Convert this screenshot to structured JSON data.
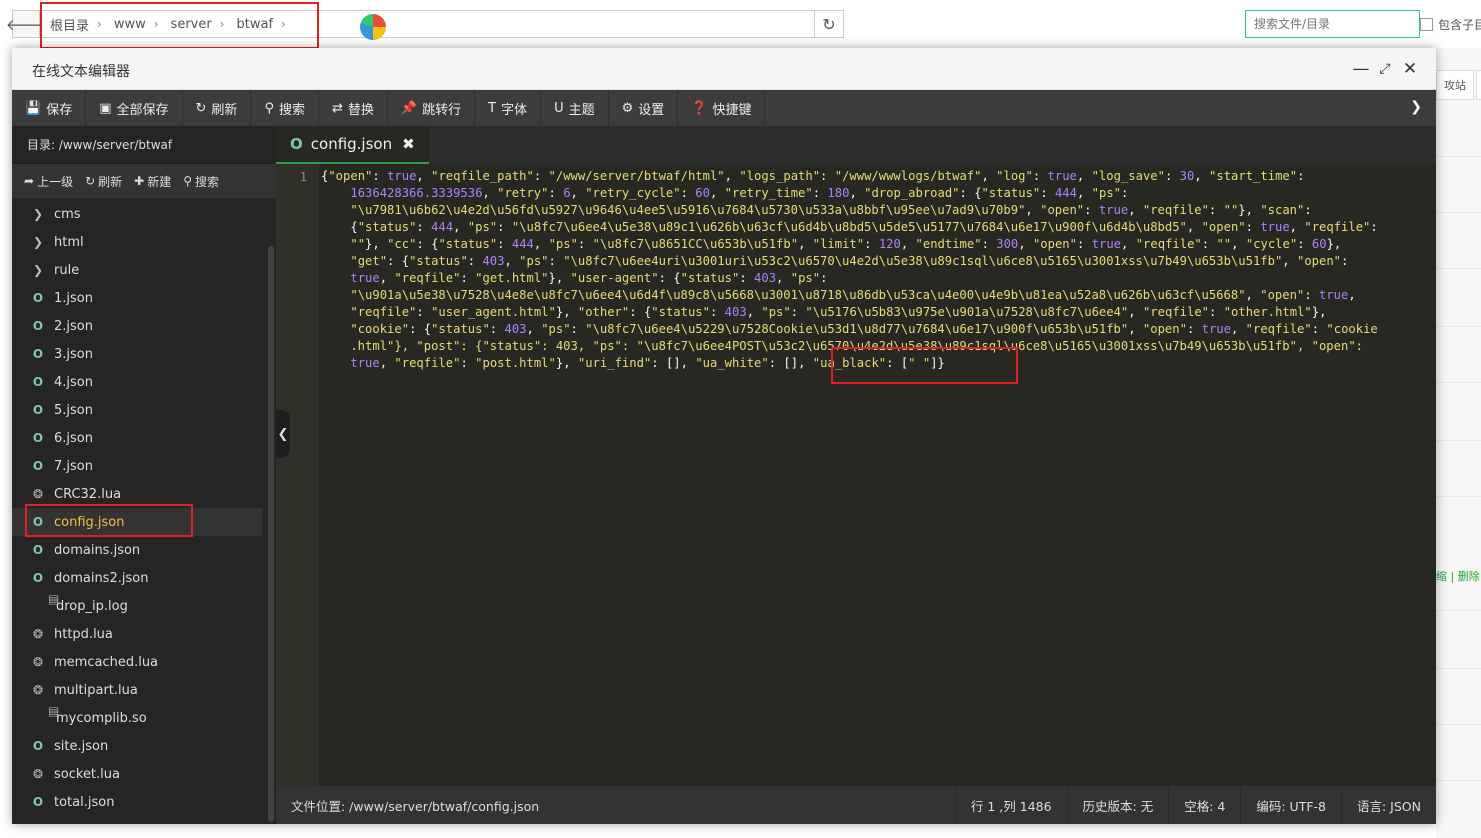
{
  "breadcrumb": {
    "items": [
      "根目录",
      "www",
      "server",
      "btwaf"
    ]
  },
  "search": {
    "placeholder": "搜索文件/目录",
    "include_sub_label": "包含子目录"
  },
  "background": {
    "tab_label": "攻站",
    "links": "缩 | 删除"
  },
  "window": {
    "title": "在线文本编辑器"
  },
  "toolbar": {
    "save": "保存",
    "save_all": "全部保存",
    "refresh": "刷新",
    "search": "搜索",
    "replace": "替换",
    "goto_line": "跳转行",
    "font": "字体",
    "theme": "主题",
    "settings": "设置",
    "shortcuts": "快捷键"
  },
  "sidebar": {
    "directory_label": "目录: /www/server/btwaf",
    "actions": {
      "up": "上一级",
      "refresh": "刷新",
      "new": "新建",
      "search": "搜索"
    },
    "files": [
      {
        "name": "cms",
        "type": "folder"
      },
      {
        "name": "html",
        "type": "folder"
      },
      {
        "name": "rule",
        "type": "folder"
      },
      {
        "name": "1.json",
        "type": "json"
      },
      {
        "name": "2.json",
        "type": "json"
      },
      {
        "name": "3.json",
        "type": "json"
      },
      {
        "name": "4.json",
        "type": "json"
      },
      {
        "name": "5.json",
        "type": "json"
      },
      {
        "name": "6.json",
        "type": "json"
      },
      {
        "name": "7.json",
        "type": "json"
      },
      {
        "name": "CRC32.lua",
        "type": "lua"
      },
      {
        "name": "config.json",
        "type": "json",
        "active": true
      },
      {
        "name": "domains.json",
        "type": "json"
      },
      {
        "name": "domains2.json",
        "type": "json"
      },
      {
        "name": "drop_ip.log",
        "type": "file"
      },
      {
        "name": "httpd.lua",
        "type": "lua"
      },
      {
        "name": "memcached.lua",
        "type": "lua"
      },
      {
        "name": "multipart.lua",
        "type": "lua"
      },
      {
        "name": "mycomplib.so",
        "type": "file"
      },
      {
        "name": "site.json",
        "type": "json"
      },
      {
        "name": "socket.lua",
        "type": "lua"
      },
      {
        "name": "total.json",
        "type": "json"
      }
    ]
  },
  "editor": {
    "tab_name": "config.json",
    "line_number": "1",
    "code_lines": [
      "{\"open\": true, \"reqfile_path\": \"/www/server/btwaf/html\", \"logs_path\": \"/www/wwwlogs/btwaf\", \"log\": true, \"log_save\": 30, \"start_time\":",
      "    1636428366.3339536, \"retry\": 6, \"retry_cycle\": 60, \"retry_time\": 180, \"drop_abroad\": {\"status\": 444, \"ps\":",
      "    \"\\u7981\\u6b62\\u4e2d\\u56fd\\u5927\\u9646\\u4ee5\\u5916\\u7684\\u5730\\u533a\\u8bbf\\u95ee\\u7ad9\\u70b9\", \"open\": true, \"reqfile\": \"\"}, \"scan\":",
      "    {\"status\": 444, \"ps\": \"\\u8fc7\\u6ee4\\u5e38\\u89c1\\u626b\\u63cf\\u6d4b\\u8bd5\\u5de5\\u5177\\u7684\\u6e17\\u900f\\u6d4b\\u8bd5\", \"open\": true, \"reqfile\":",
      "    \"\"}, \"cc\": {\"status\": 444, \"ps\": \"\\u8fc7\\u8651CC\\u653b\\u51fb\", \"limit\": 120, \"endtime\": 300, \"open\": true, \"reqfile\": \"\", \"cycle\": 60},",
      "    \"get\": {\"status\": 403, \"ps\": \"\\u8fc7\\u6ee4uri\\u3001uri\\u53c2\\u6570\\u4e2d\\u5e38\\u89c1sql\\u6ce8\\u5165\\u3001xss\\u7b49\\u653b\\u51fb\", \"open\":",
      "    true, \"reqfile\": \"get.html\"}, \"user-agent\": {\"status\": 403, \"ps\":",
      "    \"\\u901a\\u5e38\\u7528\\u4e8e\\u8fc7\\u6ee4\\u6d4f\\u89c8\\u5668\\u3001\\u8718\\u86db\\u53ca\\u4e00\\u4e9b\\u81ea\\u52a8\\u626b\\u63cf\\u5668\", \"open\": true,",
      "    \"reqfile\": \"user_agent.html\"}, \"other\": {\"status\": 403, \"ps\": \"\\u5176\\u5b83\\u975e\\u901a\\u7528\\u8fc7\\u6ee4\", \"reqfile\": \"other.html\"},",
      "    \"cookie\": {\"status\": 403, \"ps\": \"\\u8fc7\\u6ee4\\u5229\\u7528Cookie\\u53d1\\u8d77\\u7684\\u6e17\\u900f\\u653b\\u51fb\", \"open\": true, \"reqfile\": \"cookie",
      "    .html\"}, \"post\": {\"status\": 403, \"ps\": \"\\u8fc7\\u6ee4POST\\u53c2\\u6570\\u4e2d\\u5e38\\u89c1sql\\u6ce8\\u5165\\u3001xss\\u7b49\\u653b\\u51fb\", \"open\":",
      "    true, \"reqfile\": \"post.html\"}, \"uri_find\": [], \"ua_white\": [], \"ua_black\": [\" \"]}"
    ]
  },
  "statusbar": {
    "file_path": "文件位置: /www/server/btwaf/config.json",
    "cursor": "行 1 ,列 1486",
    "history": "历史版本: 无",
    "indent": "空格: 4",
    "encoding": "编码: UTF-8",
    "language": "语言: JSON"
  },
  "colors": {
    "key": "#e6db74",
    "boolean": "#ae81ff",
    "number": "#ae81ff",
    "punct": "#f8f8f2",
    "highlight": "#e02020",
    "active_file": "#f0c040"
  }
}
